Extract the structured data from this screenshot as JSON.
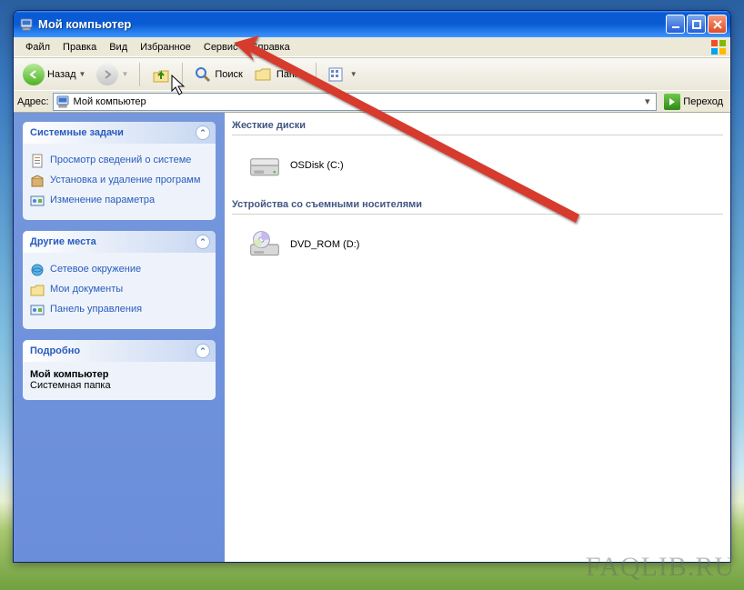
{
  "window": {
    "title": "Мой компьютер"
  },
  "menu": {
    "items": [
      "Файл",
      "Правка",
      "Вид",
      "Избранное",
      "Сервис",
      "Справка"
    ]
  },
  "toolbar": {
    "back": "Назад",
    "search": "Поиск",
    "folders": "Папки"
  },
  "addressbar": {
    "label": "Адрес:",
    "value": "Мой компьютер",
    "go": "Переход"
  },
  "sidebar": {
    "panels": [
      {
        "title": "Системные задачи",
        "items": [
          "Просмотр сведений о системе",
          "Установка и удаление программ",
          "Изменение параметра"
        ]
      },
      {
        "title": "Другие места",
        "items": [
          "Сетевое окружение",
          "Мои документы",
          "Панель управления"
        ]
      },
      {
        "title": "Подробно",
        "detail_name": "Мой компьютер",
        "detail_type": "Системная папка"
      }
    ]
  },
  "main": {
    "groups": [
      {
        "title": "Жесткие диски",
        "drives": [
          {
            "label": "OSDisk (C:)"
          }
        ]
      },
      {
        "title": "Устройства со съемными носителями",
        "drives": [
          {
            "label": "DVD_ROM (D:)"
          }
        ]
      }
    ]
  },
  "watermark": "FAQLIB.RU"
}
